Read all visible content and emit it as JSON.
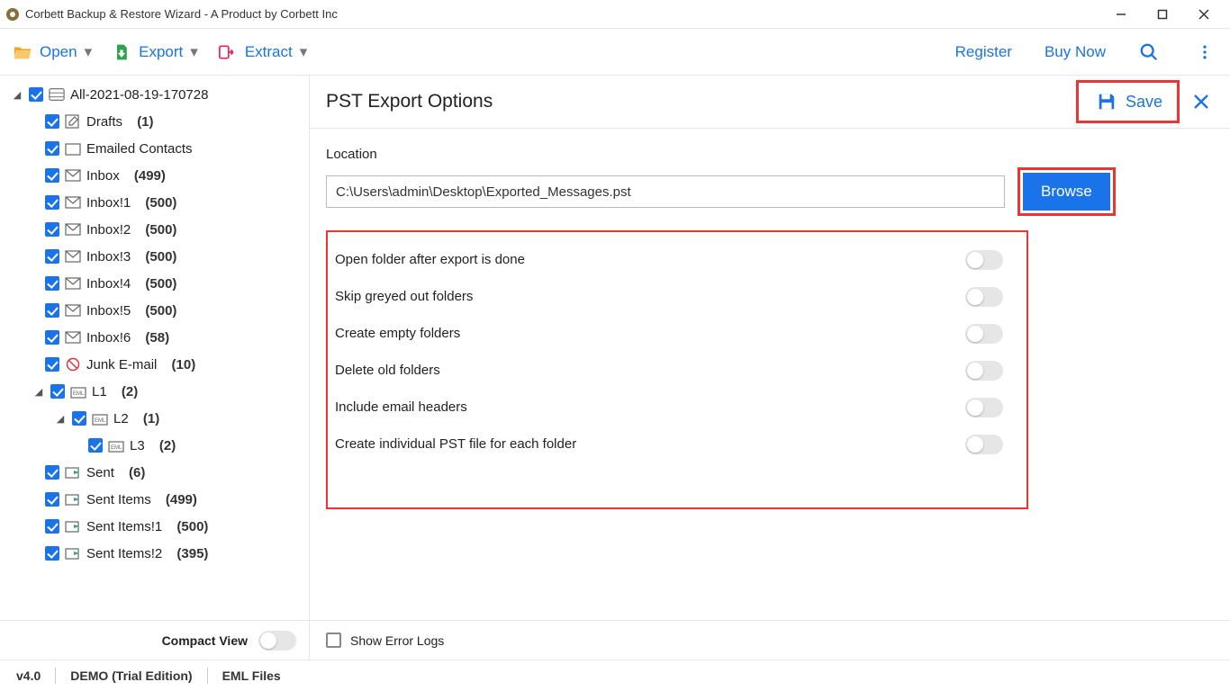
{
  "window": {
    "title": "Corbett Backup & Restore Wizard - A Product by Corbett Inc"
  },
  "toolbar": {
    "open": "Open",
    "export": "Export",
    "extract": "Extract",
    "register": "Register",
    "buynow": "Buy Now"
  },
  "tree": {
    "root": {
      "label": "All-2021-08-19-170728"
    },
    "items": [
      {
        "label": "Drafts",
        "count": "(1)"
      },
      {
        "label": "Emailed Contacts"
      },
      {
        "label": "Inbox",
        "count": "(499)"
      },
      {
        "label": "Inbox!1",
        "count": "(500)"
      },
      {
        "label": "Inbox!2",
        "count": "(500)"
      },
      {
        "label": "Inbox!3",
        "count": "(500)"
      },
      {
        "label": "Inbox!4",
        "count": "(500)"
      },
      {
        "label": "Inbox!5",
        "count": "(500)"
      },
      {
        "label": "Inbox!6",
        "count": "(58)"
      },
      {
        "label": "Junk E-mail",
        "count": "(10)"
      },
      {
        "label": "L1",
        "count": "(2)"
      },
      {
        "label": "L2",
        "count": "(1)"
      },
      {
        "label": "L3",
        "count": "(2)"
      },
      {
        "label": "Sent",
        "count": "(6)"
      },
      {
        "label": "Sent Items",
        "count": "(499)"
      },
      {
        "label": "Sent Items!1",
        "count": "(500)"
      },
      {
        "label": "Sent Items!2",
        "count": "(395)"
      }
    ],
    "compact_label": "Compact View"
  },
  "panel": {
    "title": "PST Export Options",
    "save": "Save",
    "location_label": "Location",
    "location_value": "C:\\Users\\admin\\Desktop\\Exported_Messages.pst",
    "browse": "Browse",
    "options": [
      "Open folder after export is done",
      "Skip greyed out folders",
      "Create empty folders",
      "Delete old folders",
      "Include email headers",
      "Create individual PST file for each folder"
    ],
    "show_errors": "Show Error Logs"
  },
  "status": {
    "version": "v4.0",
    "edition": "DEMO (Trial Edition)",
    "format": "EML Files"
  }
}
